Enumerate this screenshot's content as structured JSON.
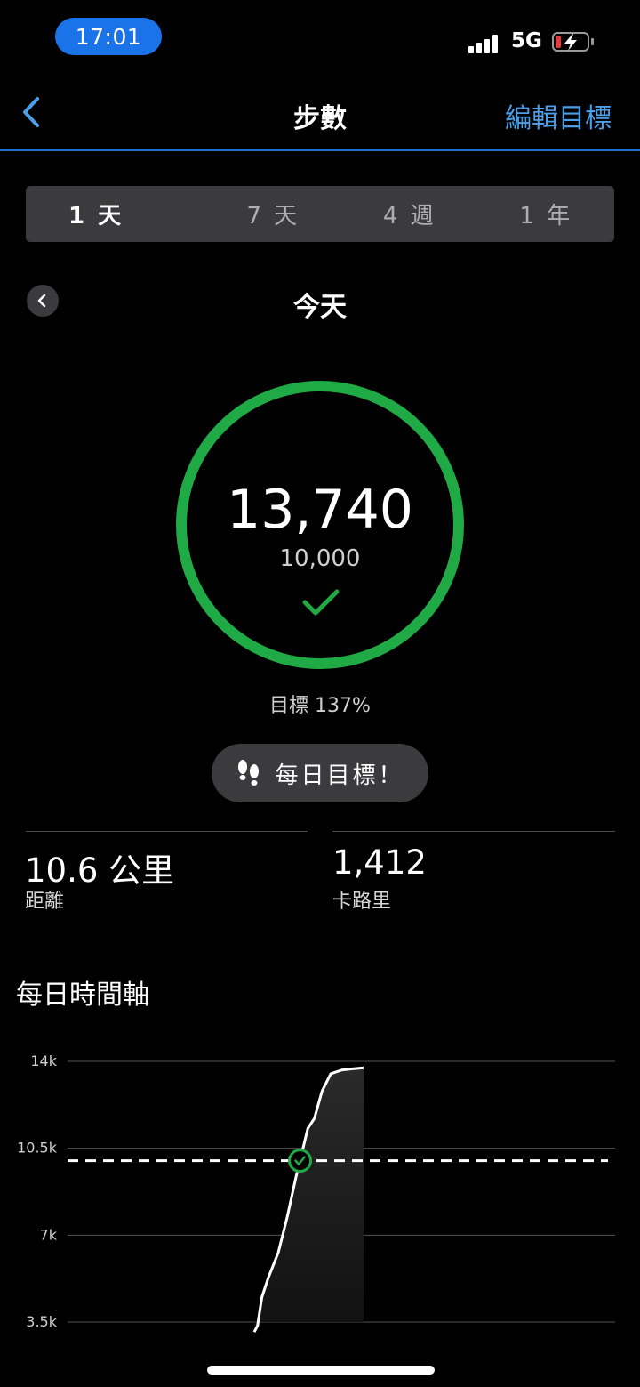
{
  "status_bar": {
    "time": "17:01",
    "network": "5G"
  },
  "header": {
    "title": "步數",
    "edit_goal": "編輯目標"
  },
  "tabs": [
    {
      "label": "1 天",
      "active": true
    },
    {
      "label": "7 天",
      "active": false
    },
    {
      "label": "4 週",
      "active": false
    },
    {
      "label": "1 年",
      "active": false
    }
  ],
  "day_nav": {
    "label": "今天"
  },
  "summary": {
    "steps": "13,740",
    "goal": "10,000",
    "goal_percent_text": "目標 137%",
    "progress_fraction": 1.0
  },
  "badge": {
    "label": "每日目標！"
  },
  "stats": {
    "distance": {
      "value": "10.6 公里",
      "label": "距離"
    },
    "calories": {
      "value": "1,412",
      "label": "卡路里"
    }
  },
  "timeline": {
    "title": "每日時間軸"
  },
  "chart_data": {
    "type": "area",
    "y_ticks": [
      "14k",
      "10.5k",
      "7k",
      "3.5k"
    ],
    "ylim": [
      3500,
      14000
    ],
    "goal_line": 10000,
    "series": [
      {
        "values": [
          [
            0,
            3100
          ],
          [
            0.03,
            3350
          ],
          [
            0.07,
            4500
          ],
          [
            0.13,
            5300
          ],
          [
            0.22,
            6300
          ],
          [
            0.3,
            7700
          ],
          [
            0.38,
            9300
          ],
          [
            0.43,
            10200
          ],
          [
            0.49,
            11300
          ],
          [
            0.55,
            11700
          ],
          [
            0.62,
            12800
          ],
          [
            0.7,
            13500
          ],
          [
            0.8,
            13650
          ],
          [
            0.9,
            13700
          ],
          [
            1.0,
            13740
          ]
        ]
      }
    ],
    "colors": {
      "line": "#ffffff",
      "goal_marker": "#1faa45"
    }
  },
  "colors": {
    "accent": "#1a73e8",
    "ring": "#1faa45",
    "link": "#4a9fe8"
  }
}
